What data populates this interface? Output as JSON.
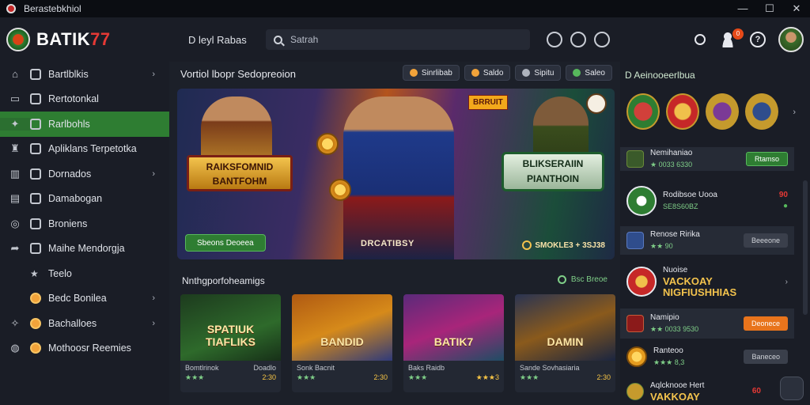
{
  "window": {
    "title": "Berastebkhiol",
    "controls": [
      "—",
      "☐",
      "✕"
    ]
  },
  "topbar": {
    "logo_main": "BATIK",
    "logo_accent": "77",
    "nav_label": "D leyl Rabas",
    "search_placeholder": "Satrah",
    "notification_count": "0",
    "help_icon": "?"
  },
  "sidebar": {
    "items": [
      {
        "label": "Bartlblkis",
        "gutter_icon": "home-icon",
        "chevron": "›"
      },
      {
        "label": "Rertotonkal",
        "gutter_icon": "monitor-icon",
        "chevron": ""
      },
      {
        "label": "Rarlbohls",
        "gutter_icon": "gamepad-icon",
        "chevron": "",
        "active": true
      },
      {
        "label": "Apliklans Terpetotka",
        "gutter_icon": "trophy-icon",
        "chevron": ""
      },
      {
        "label": "Dornados",
        "gutter_icon": "chart-icon",
        "chevron": "›"
      },
      {
        "label": "Damabogan",
        "gutter_icon": "card-icon",
        "chevron": ""
      },
      {
        "label": "Broniens",
        "gutter_icon": "target-icon",
        "chevron": ""
      },
      {
        "label": "Maihe Mendorgja",
        "gutter_icon": "share-icon",
        "chevron": ""
      },
      {
        "label": "Teelo",
        "gutter_icon": "",
        "chevron": ""
      },
      {
        "label": "Bedc Bonilea",
        "gutter_icon": "",
        "chevron": "›"
      },
      {
        "label": "Bachalloes",
        "gutter_icon": "tools-icon",
        "chevron": "›"
      },
      {
        "label": "Mothoosr Reemies",
        "gutter_icon": "globe-icon",
        "chevron": ""
      }
    ]
  },
  "main": {
    "section_title": "Vortiol  lbopr Sedopreoion",
    "pills": [
      {
        "label": "Sinrlibab",
        "color": "#f2a33a"
      },
      {
        "label": "Saldo",
        "color": "#f2a33a"
      },
      {
        "label": "Sipitu",
        "color": "#aeb3bd"
      },
      {
        "label": "Saleo",
        "color": "#57b85c"
      }
    ],
    "banner": {
      "title_left_1": "RAIKSFOMNID",
      "title_left_2": "BANTFOHM",
      "title_right_1": "BLIKSERAIIN",
      "title_right_2": "PIANTHOIN",
      "tag": "BRRUIT",
      "cta": "Sbeons Deoeea",
      "caption": "DRCATIBSY",
      "stat": "SMOKLE3 + 3SJ38"
    },
    "games_title": "Nnthgporfoheamigs",
    "games_link": "Bsc Breoe",
    "games": [
      {
        "thumb_title": "SPATIUK TIAFLIKS",
        "name": "Bomtlrinok",
        "tag": "Doadlo",
        "stars": "★★★",
        "rate": "2:30"
      },
      {
        "thumb_title": "BANDID",
        "name": "Sonk Bacnit",
        "tag": "",
        "stars": "★★★",
        "rate": "2:30"
      },
      {
        "thumb_title": "BATIK7",
        "name": "Baks Raidb",
        "tag": "",
        "stars": "★★★",
        "rate": "★★★3"
      },
      {
        "thumb_title": "DAMIN",
        "name": "Sande Sovhasiaria",
        "tag": "",
        "stars": "★★★",
        "rate": "2:30"
      }
    ]
  },
  "rightpanel": {
    "title": "D  Aeinooeerlbua",
    "rows": [
      {
        "name": "Nemihaniao",
        "sub": "★ 0033 6330",
        "action": "Rtamso",
        "action_style": "green"
      },
      {
        "name": "Rodibsoe Uooa",
        "sub": "SE8S60BZ",
        "score": "90",
        "score2": "●"
      },
      {
        "name": "Renose Ririka",
        "sub": "★★ 90",
        "action": "Beeeone",
        "action_style": "grey"
      },
      {
        "name": "Nuoise",
        "promo": "VACKOAY",
        "promo2": "NIGFIUSHHIAS"
      },
      {
        "name": "Namipio",
        "sub": "★★ 0033 9530",
        "action": "Deonece",
        "action_style": "orange"
      },
      {
        "name": "Ranteoo",
        "sub": "★★★ 8,3",
        "action": "Baneceo",
        "action_style": "grey"
      },
      {
        "name": "Aqlcknooe Hert",
        "promo": "VAKKOAY",
        "score": "60"
      }
    ]
  }
}
